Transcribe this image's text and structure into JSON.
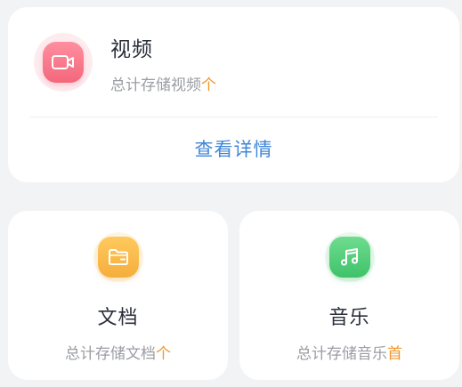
{
  "video": {
    "title": "视频",
    "subtitle": "总计存储视频",
    "unit": "个",
    "detail_link": "查看详情",
    "icon": "video-camera-icon",
    "color": "#f3677c"
  },
  "docs": {
    "title": "文档",
    "subtitle": "总计存储文档",
    "unit": "个",
    "icon": "folder-icon",
    "color": "#f5ae3c"
  },
  "music": {
    "title": "音乐",
    "subtitle": "总计存储音乐",
    "unit": "首",
    "icon": "music-note-icon",
    "color": "#3fc26a"
  },
  "accent_unit_color": "#f0962d",
  "link_color": "#3f86d8"
}
